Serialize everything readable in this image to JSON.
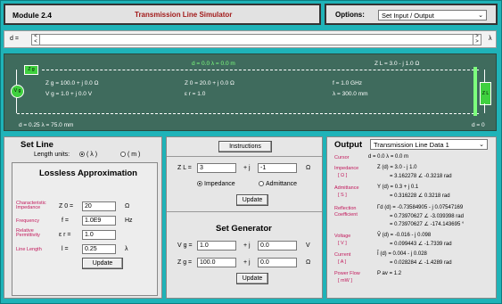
{
  "header": {
    "module": "Module 2.4",
    "title": "Transmission Line Simulator"
  },
  "options": {
    "label": "Options:",
    "selected": "Set Input / Output"
  },
  "dbar": {
    "label": "d =",
    "unit": "λ"
  },
  "tline": {
    "zg_box": "Z g",
    "vg_box": "V g",
    "zl_box": "Z L",
    "top_center": "d = 0.0 λ = 0.0 m",
    "zl_top": "Z L = 3.0 - j 1.0  Ω",
    "zg_line": "Z g = 100.0 + j 0.0  Ω",
    "vg_line": "V g = 1.0 + j 0.0 V",
    "z0_line": "Z 0 = 20.0 + j 0.0  Ω",
    "er_line": "ε r = 1.0",
    "f_line": "f = 1.0 GHz",
    "lambda_line": "λ = 300.0 mm",
    "bottom_left": "d = 0.25 λ = 75.0 mm",
    "bottom_right": "d = 0"
  },
  "setline": {
    "title": "Set Line",
    "units_label": "Length units:",
    "unit_lambda": "( λ )",
    "unit_m": "( m )",
    "lossless": "Lossless Approximation",
    "char_label": "Characteristic Impedance",
    "freq_label": "Frequency",
    "perm_label": "Relative Permittivity",
    "len_label": "Line Length",
    "z0_sym": "Z 0 =",
    "f_sym": "f =",
    "er_sym": "ε r =",
    "l_sym": "l =",
    "z0_val": "20",
    "f_val": "1.0E9",
    "er_val": "1.0",
    "l_val": "0.25",
    "z0_unit": "Ω",
    "f_unit": "Hz",
    "l_unit": "λ",
    "update": "Update"
  },
  "middle": {
    "instructions": "Instructions",
    "zl_sym": "Z L =",
    "zl_re": "3",
    "zl_im": "-1",
    "plus_j": "+ j",
    "ohm": "Ω",
    "opt_imp": "Impedance",
    "opt_adm": "Admittance",
    "update1": "Update",
    "setgen": "Set Generator",
    "vg_sym": "V g =",
    "vg_re": "1.0",
    "vg_im": "0.0",
    "vg_unit": "V",
    "zg_sym": "Z g =",
    "zg_re": "100.0",
    "zg_im": "0.0",
    "zg_unit": "Ω",
    "update2": "Update"
  },
  "output": {
    "title": "Output",
    "selected": "Transmission Line Data 1",
    "cursor_label": "Cursor",
    "cursor_val": "d = 0.0 λ = 0.0 m",
    "imp_label": "Impedance",
    "imp_unit": "[ Ω ]",
    "imp_l1": "Z (d)  = 3.0 - j 1.0",
    "imp_l2": "= 3.162278  ∠ -0.3218 rad",
    "adm_label": "Admittance",
    "adm_unit": "[ S ]",
    "adm_l1": "Y (d)  = 0.3 + j 0.1",
    "adm_l2": "= 0.316228  ∠ 0.3218 rad",
    "refl_label": "Reflection Coefficient",
    "refl_l1": "Γd (d)  = -0.73584905 - j 0.07547169",
    "refl_l2": "= 0.73970627  ∠ -3.039398 rad",
    "refl_l3": "= 0.73970627  ∠ -174.143695 °",
    "volt_label": "Voltage",
    "volt_unit": "[ V ]",
    "volt_l1": "Ṽ (d)  = -0.016 - j 0.098",
    "volt_l2": "= 0.099443  ∠ -1.7339 rad",
    "cur_label": "Current",
    "cur_unit": "[ A ]",
    "cur_l1": "Ĩ (d)  = 0.004 - j 0.028",
    "cur_l2": "= 0.028284  ∠ -1.4289 rad",
    "pow_label": "Power Flow",
    "pow_unit": "[ mW ]",
    "pow_l1": "P av  = 1.2"
  }
}
